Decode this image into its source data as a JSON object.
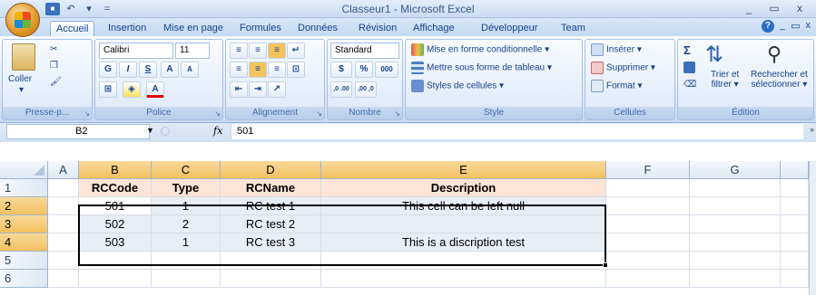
{
  "window": {
    "title": "Classeur1 - Microsoft Excel",
    "controls": [
      "_",
      "▭",
      "x"
    ]
  },
  "qat": {
    "save": "💾",
    "undo": "↶",
    "undo_drop": "▾",
    "customize": "="
  },
  "tabs": [
    {
      "label": "Accueil",
      "active": true
    },
    {
      "label": "Insertion"
    },
    {
      "label": "Mise en page"
    },
    {
      "label": "Formules"
    },
    {
      "label": "Données"
    },
    {
      "label": "Révision"
    },
    {
      "label": "Affichage"
    },
    {
      "label": "Développeur"
    },
    {
      "label": "Team"
    }
  ],
  "ribbon_right": {
    "help": "?",
    "min": "_",
    "restore": "▭",
    "close": "x"
  },
  "ribbon": {
    "clipboard": {
      "label": "Presse-p...",
      "paste": "Coller"
    },
    "font": {
      "label": "Police",
      "name": "Calibri",
      "size": "11",
      "bold": "G",
      "italic": "I",
      "underline": "S",
      "grow": "A",
      "shrink": "A",
      "color": "A"
    },
    "alignment": {
      "label": "Alignement"
    },
    "number": {
      "label": "Nombre",
      "format": "Standard",
      "percent": "%",
      "thousands": "000",
      "inc": ",0 .00",
      "dec": ",00 ,0"
    },
    "style": {
      "label": "Style",
      "cond": "Mise en forme conditionnelle",
      "table": "Mettre sous forme de tableau",
      "cell": "Styles de cellules"
    },
    "cells": {
      "label": "Cellules",
      "insert": "Insérer",
      "delete": "Supprimer",
      "format": "Format"
    },
    "editing": {
      "label": "Édition",
      "sigma": "Σ",
      "sort": "Trier et filtrer",
      "find": "Rechercher et sélectionner",
      "sort_line1": "Trier et",
      "sort_line2": "filtrer",
      "find_line1": "Rechercher et",
      "find_line2": "sélectionner"
    }
  },
  "formula_bar": {
    "name_box": "B2",
    "fx": "fx",
    "value": "501"
  },
  "columns": [
    "A",
    "B",
    "C",
    "D",
    "E",
    "F",
    "G"
  ],
  "rows": [
    "1",
    "2",
    "3",
    "4",
    "5",
    "6"
  ],
  "headers": [
    "RCCode",
    "Type",
    "RCName",
    "Description"
  ],
  "data": [
    [
      "501",
      "1",
      "RC test 1",
      "This cell can be left null"
    ],
    [
      "502",
      "2",
      "RC test 2",
      ""
    ],
    [
      "503",
      "1",
      "RC test 3",
      "This is a discription test"
    ]
  ],
  "colors": {
    "header_fill": "#fce4d6",
    "selection_fill": "#e8eef6",
    "selected_header": "#f1c15f"
  }
}
